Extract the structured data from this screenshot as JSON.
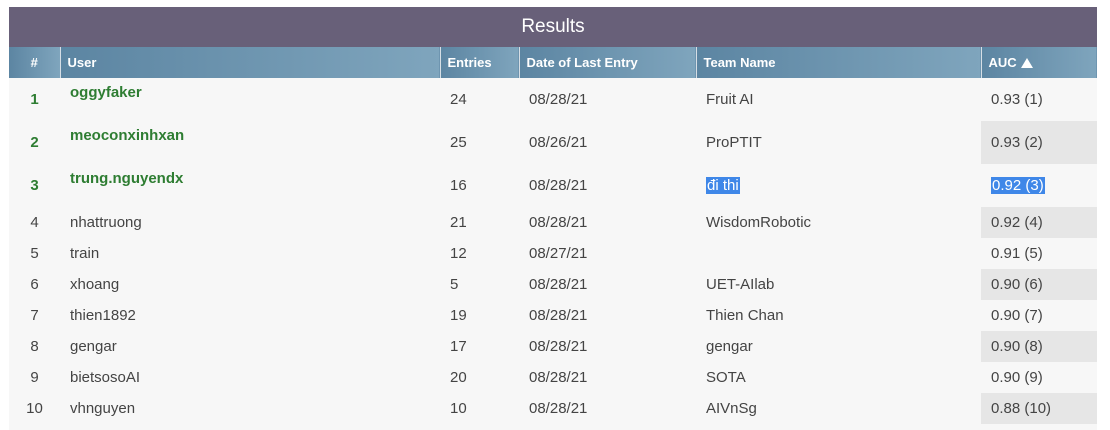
{
  "title": "Results",
  "columns": {
    "rank": "#",
    "user": "User",
    "entries": "Entries",
    "date": "Date of Last Entry",
    "team": "Team Name",
    "auc": "AUC"
  },
  "sort_icon": "triangle-up-icon",
  "rows": [
    {
      "rank": "1",
      "user": "oggyfaker",
      "entries": "24",
      "date": "08/28/21",
      "team": "Fruit AI",
      "auc": "0.93 (1)"
    },
    {
      "rank": "2",
      "user": "meoconxinhxan",
      "entries": "25",
      "date": "08/26/21",
      "team": "ProPTIT",
      "auc": "0.93 (2)"
    },
    {
      "rank": "3",
      "user": "trung.nguyendx",
      "entries": "16",
      "date": "08/28/21",
      "team": "đi thi",
      "auc": "0.92 (3)"
    },
    {
      "rank": "4",
      "user": "nhattruong",
      "entries": "21",
      "date": "08/28/21",
      "team": "WisdomRobotic",
      "auc": "0.92 (4)"
    },
    {
      "rank": "5",
      "user": "train",
      "entries": "12",
      "date": "08/27/21",
      "team": "",
      "auc": "0.91 (5)"
    },
    {
      "rank": "6",
      "user": "xhoang",
      "entries": "5",
      "date": "08/28/21",
      "team": "UET-AIlab",
      "auc": "0.90 (6)"
    },
    {
      "rank": "7",
      "user": "thien1892",
      "entries": "19",
      "date": "08/28/21",
      "team": "Thien Chan",
      "auc": "0.90 (7)"
    },
    {
      "rank": "8",
      "user": "gengar",
      "entries": "17",
      "date": "08/28/21",
      "team": "gengar",
      "auc": "0.90 (8)"
    },
    {
      "rank": "9",
      "user": "bietsosoAI",
      "entries": "20",
      "date": "08/28/21",
      "team": "SOTA",
      "auc": "0.90 (9)"
    },
    {
      "rank": "10",
      "user": "vhnguyen",
      "entries": "10",
      "date": "08/28/21",
      "team": "AIVnSg",
      "auc": "0.88 (10)"
    }
  ]
}
